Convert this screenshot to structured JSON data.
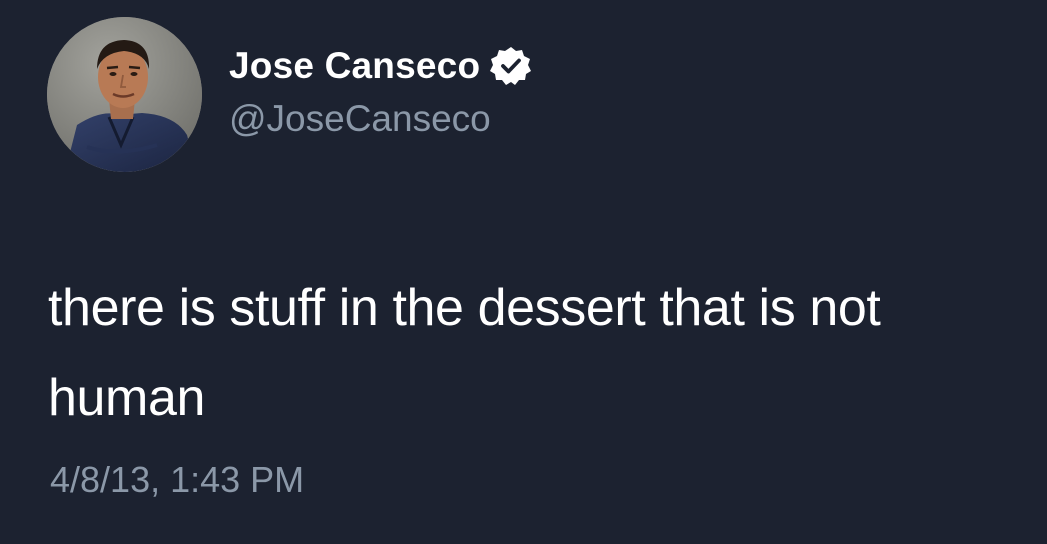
{
  "tweet": {
    "author": {
      "display_name": "Jose Canseco",
      "handle": "@JoseCanseco",
      "verified": true,
      "verified_icon": "verified-badge-icon"
    },
    "text": "there is stuff in the dessert that is not human",
    "timestamp": "4/8/13, 1:43 PM"
  },
  "colors": {
    "background": "#1c2230",
    "primary_text": "#ffffff",
    "secondary_text": "#8b98a8"
  }
}
